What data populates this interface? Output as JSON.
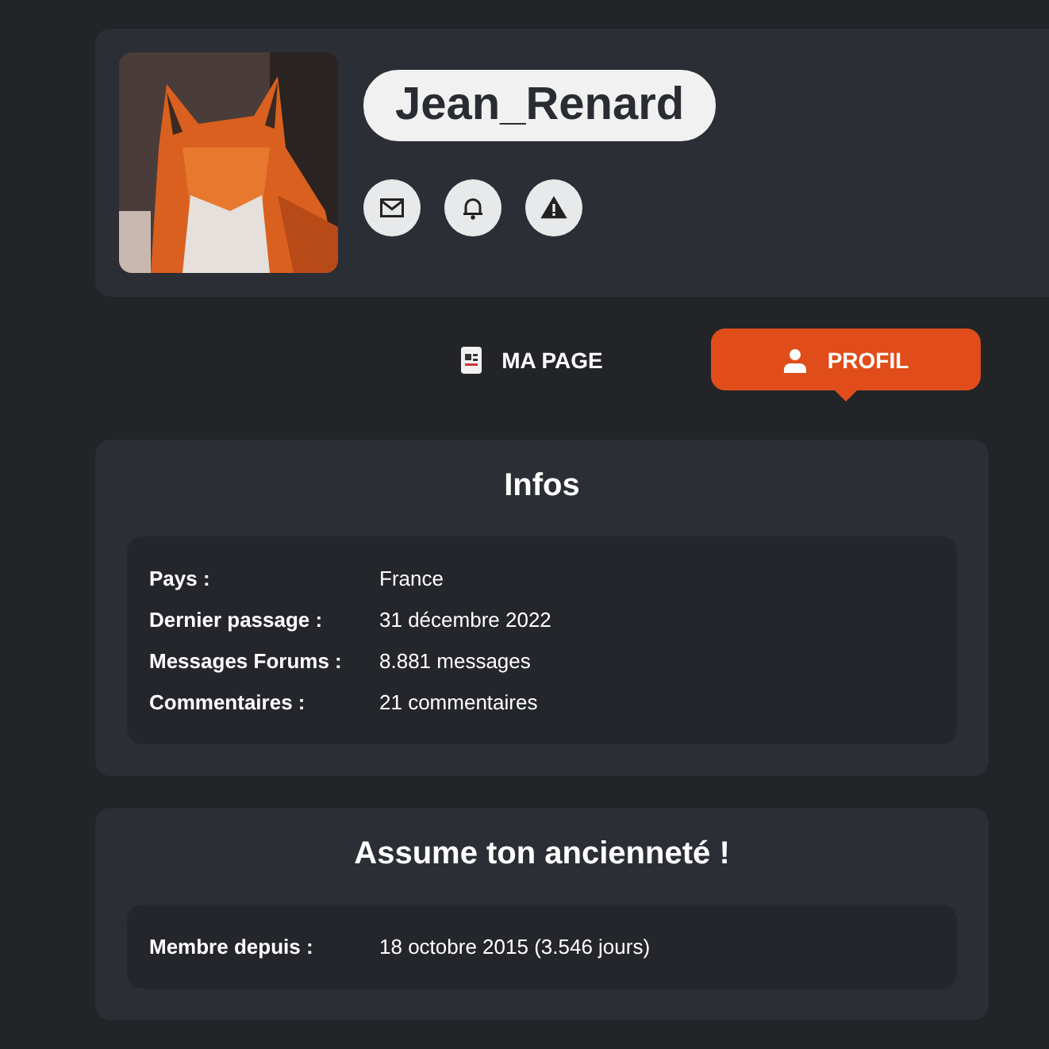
{
  "profile": {
    "username": "Jean_Renard"
  },
  "tabs": [
    {
      "label": "MA PAGE",
      "selected": false
    },
    {
      "label": "PROFIL",
      "selected": true
    }
  ],
  "sections": [
    {
      "title": "Infos",
      "rows": [
        {
          "label": "Pays :",
          "value": "France"
        },
        {
          "label": "Dernier passage :",
          "value": "31 décembre 2022"
        },
        {
          "label": "Messages Forums :",
          "value": "8.881 messages"
        },
        {
          "label": "Commentaires :",
          "value": "21 commentaires"
        }
      ]
    },
    {
      "title": "Assume ton ancienneté !",
      "rows": [
        {
          "label": "Membre depuis :",
          "value": "18 octobre 2015 (3.546 jours)"
        }
      ]
    }
  ]
}
